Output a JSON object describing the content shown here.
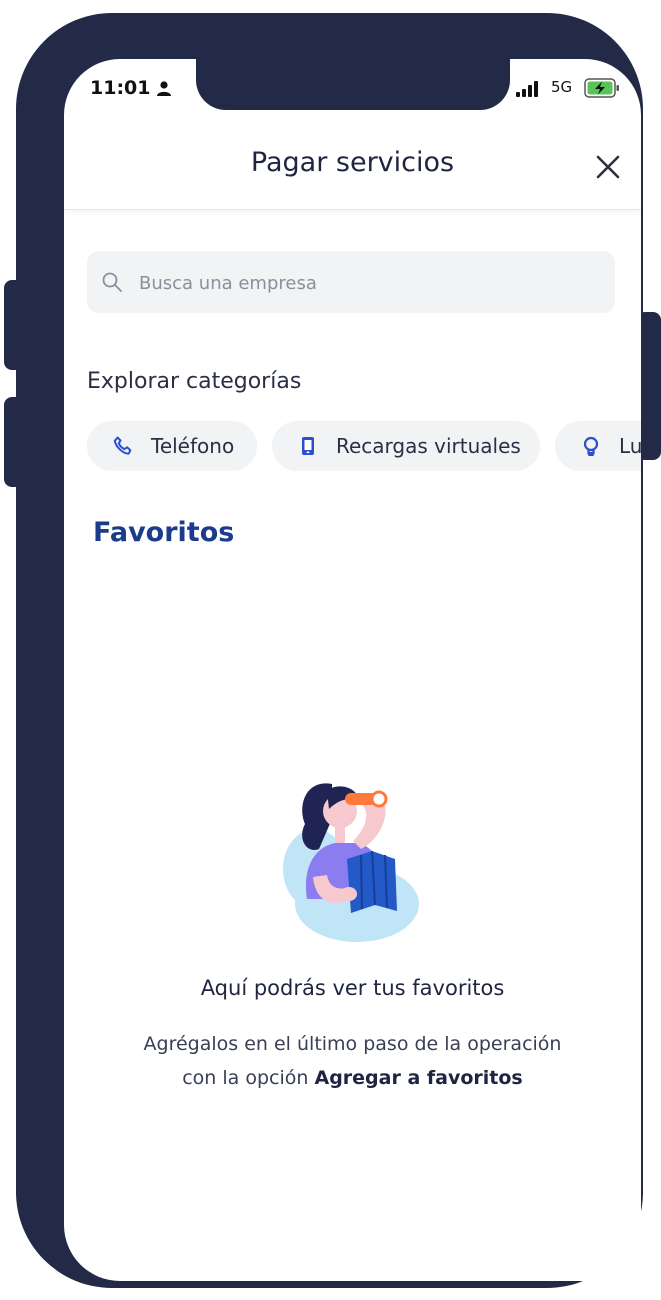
{
  "status_bar": {
    "time": "11:01",
    "network": "5G"
  },
  "header": {
    "title": "Pagar servicios"
  },
  "search": {
    "placeholder": "Busca una empresa",
    "value": ""
  },
  "categories": {
    "label": "Explorar categorías",
    "items": [
      {
        "label": "Teléfono",
        "icon": "phone-icon"
      },
      {
        "label": "Recargas virtuales",
        "icon": "mobile-icon"
      },
      {
        "label": "Lu",
        "icon": "lightbulb-icon"
      }
    ]
  },
  "favorites": {
    "title": "Favoritos",
    "empty_title": "Aquí podrás ver tus favoritos",
    "empty_line1": "Agrégalos en el último paso de la operación",
    "empty_line2_prefix": "con la opción",
    "empty_line2_bold": "Agregar a favoritos"
  },
  "colors": {
    "frame": "#232a48",
    "accent": "#1b3b8c",
    "chip_bg": "#f2f3f5",
    "icon_blue": "#2b4fcf"
  }
}
